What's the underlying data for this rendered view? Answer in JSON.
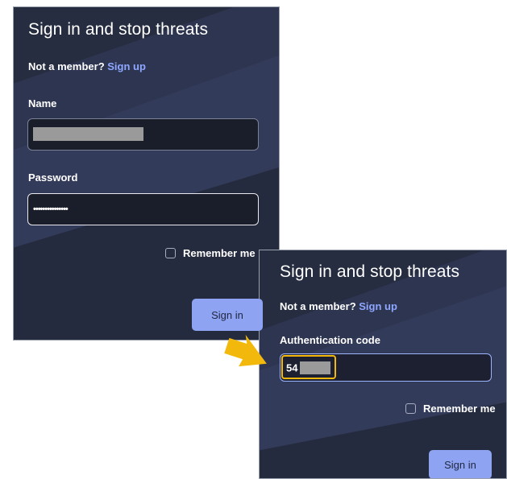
{
  "colors": {
    "panel_bg": "#262d40",
    "band": "#323a58",
    "link": "#8ea7ff",
    "button": "#8ea4f2",
    "highlight": "#f2b90c",
    "arrow": "#f2b90c"
  },
  "login_step": {
    "title": "Sign in and stop threats",
    "member_prompt": "Not a member?",
    "signup_link": "Sign up",
    "name_label": "Name",
    "name_value_redacted": true,
    "password_label": "Password",
    "password_value": "•••••••••••••••",
    "remember_label": "Remember me",
    "sign_in_button": "Sign in"
  },
  "auth_step": {
    "title": "Sign in and stop threats",
    "member_prompt": "Not a member?",
    "signup_link": "Sign up",
    "code_label": "Authentication code",
    "code_value_visible": "54",
    "remember_label": "Remember me",
    "sign_in_button": "Sign in"
  },
  "icons": {
    "pointer": "arrow-right-icon"
  }
}
